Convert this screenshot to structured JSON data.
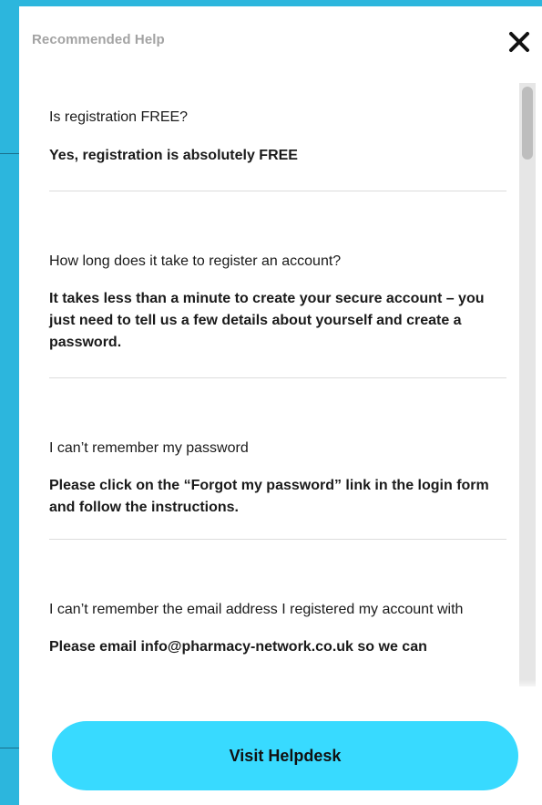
{
  "panel": {
    "title": "Recommended Help",
    "close_icon": "close-icon"
  },
  "faqs": [
    {
      "question": "Is registration FREE?",
      "answer": "Yes, registration is absolutely FREE"
    },
    {
      "question": "How long does it take to register an account?",
      "answer": "It takes less than a minute to create your secure account – you just need to tell us a few details about yourself and create a password."
    },
    {
      "question": "I can’t remember my password",
      "answer": "Please click on the “Forgot my password” link in the login form and follow the instructions."
    },
    {
      "question": "I can’t remember the email address I registered my account with",
      "answer": "Please email info@pharmacy-network.co.uk so we can"
    }
  ],
  "footer": {
    "button_label": "Visit Helpdesk"
  },
  "colors": {
    "background": "#2cb6dd",
    "button": "#38daff",
    "panel": "#ffffff"
  }
}
